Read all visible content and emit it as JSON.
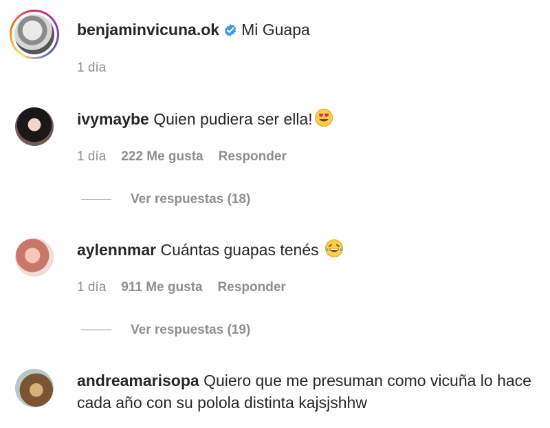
{
  "caption": {
    "username": "benjaminvicuna.ok",
    "text": "Mi Guapa",
    "time": "1 día"
  },
  "comments": [
    {
      "username": "ivymaybe",
      "text": "Quien pudiera ser ella!",
      "emoji": "heart-eyes-emoji",
      "time": "1 día",
      "likes": "222 Me gusta",
      "reply": "Responder",
      "view_replies": "Ver respuestas (18)"
    },
    {
      "username": "aylennmar",
      "text": "Cuántas guapas tenés",
      "emoji": "tears-of-joy-emoji",
      "time": "1 día",
      "likes": "911 Me gusta",
      "reply": "Responder",
      "view_replies": "Ver respuestas (19)"
    },
    {
      "username": "andreamarisopa",
      "text": "Quiero que me presuman como vicuña lo hace cada año con su polola distinta kajsjshhw"
    }
  ]
}
